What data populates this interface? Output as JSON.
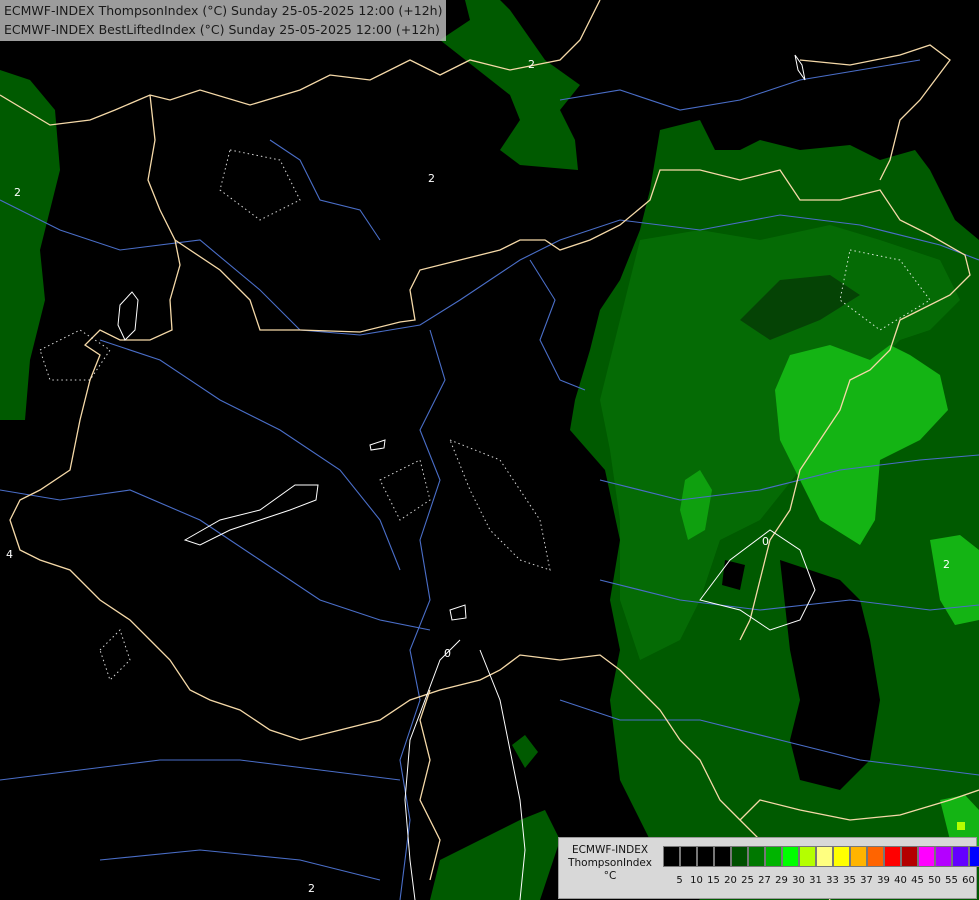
{
  "header": {
    "line1": "ECMWF-INDEX ThompsonIndex (°C) Sunday 25-05-2025 12:00 (+12h)",
    "line2": "ECMWF-INDEX BestLiftedIndex (°C) Sunday 25-05-2025 12:00 (+12h)"
  },
  "legend": {
    "label_line1": "ECMWF-INDEX",
    "label_line2": "ThompsonIndex",
    "label_line3": "°C",
    "classes": [
      {
        "value": "5",
        "color": "#000000"
      },
      {
        "value": "10",
        "color": "#000000"
      },
      {
        "value": "15",
        "color": "#000000"
      },
      {
        "value": "20",
        "color": "#000000"
      },
      {
        "value": "25",
        "color": "#005000"
      },
      {
        "value": "27",
        "color": "#007800"
      },
      {
        "value": "29",
        "color": "#00b400"
      },
      {
        "value": "30",
        "color": "#00ff00"
      },
      {
        "value": "31",
        "color": "#b4ff00"
      },
      {
        "value": "33",
        "color": "#ffff80"
      },
      {
        "value": "35",
        "color": "#ffff00"
      },
      {
        "value": "37",
        "color": "#ffb400"
      },
      {
        "value": "39",
        "color": "#ff6400"
      },
      {
        "value": "40",
        "color": "#ff0000"
      },
      {
        "value": "45",
        "color": "#b40000"
      },
      {
        "value": "50",
        "color": "#ff00ff"
      },
      {
        "value": "55",
        "color": "#b400ff"
      },
      {
        "value": "60",
        "color": "#6400ff"
      }
    ],
    "extra_swatch": "#0000ff"
  },
  "contour_labels": [
    "2",
    "2",
    "4",
    "0",
    "2",
    "0",
    "2",
    "2"
  ],
  "colors": {
    "background": "#000000",
    "border": "#f5d9a8",
    "river": "#4a6ec8",
    "contour": "#ffffff",
    "field_dark": "#005a00",
    "field_mid": "#0a8c0a",
    "field_light": "#14b414"
  }
}
